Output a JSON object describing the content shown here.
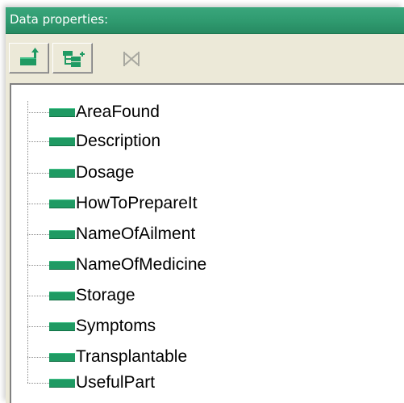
{
  "panel": {
    "title": "Data properties:"
  },
  "toolbar": {
    "buttons": [
      {
        "icon": "add-property-icon",
        "enabled": true
      },
      {
        "icon": "add-subproperty-icon",
        "enabled": true
      },
      {
        "icon": "delete-property-icon",
        "enabled": false
      }
    ]
  },
  "tree": {
    "items": [
      {
        "label": "AreaFound"
      },
      {
        "label": "Description"
      },
      {
        "label": "Dosage"
      },
      {
        "label": "HowToPrepareIt"
      },
      {
        "label": "NameOfAilment"
      },
      {
        "label": "NameOfMedicine"
      },
      {
        "label": "Storage"
      },
      {
        "label": "Symptoms"
      },
      {
        "label": "Transplantable"
      },
      {
        "label": "UsefulPart"
      }
    ]
  },
  "colors": {
    "title_bar": "#2f9a6f",
    "property_icon": "#1f9a63",
    "panel_background": "#ece9d8"
  }
}
